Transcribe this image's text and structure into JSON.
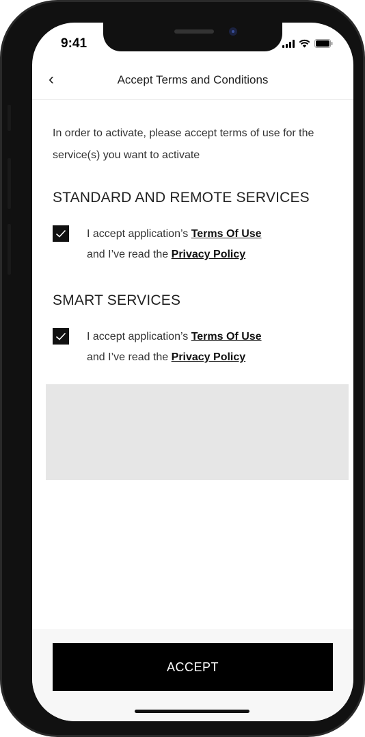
{
  "status_bar": {
    "time": "9:41",
    "icons": [
      "signal-icon",
      "wifi-icon",
      "battery-icon"
    ]
  },
  "nav": {
    "back_icon": "chevron-left-icon",
    "title": "Accept Terms and Conditions"
  },
  "intro": "In order to activate, please accept terms of use for the service(s) you want to activate",
  "sections": [
    {
      "title": "STANDARD AND REMOTE SERVICES",
      "checked": true,
      "line1_prefix": "I accept application’s ",
      "line1_link": "Terms Of Use",
      "line2_prefix": "and I’ve read the ",
      "line2_link": "Privacy Policy"
    },
    {
      "title": "SMART SERVICES",
      "checked": true,
      "line1_prefix": "I accept application’s ",
      "line1_link": "Terms Of Use",
      "line2_prefix": "and I’ve read the ",
      "line2_link": "Privacy Policy"
    }
  ],
  "accept_button": "ACCEPT",
  "colors": {
    "accent": "#000000",
    "placeholder_block": "#e6e6e6",
    "footer_bg": "#f7f7f7"
  }
}
